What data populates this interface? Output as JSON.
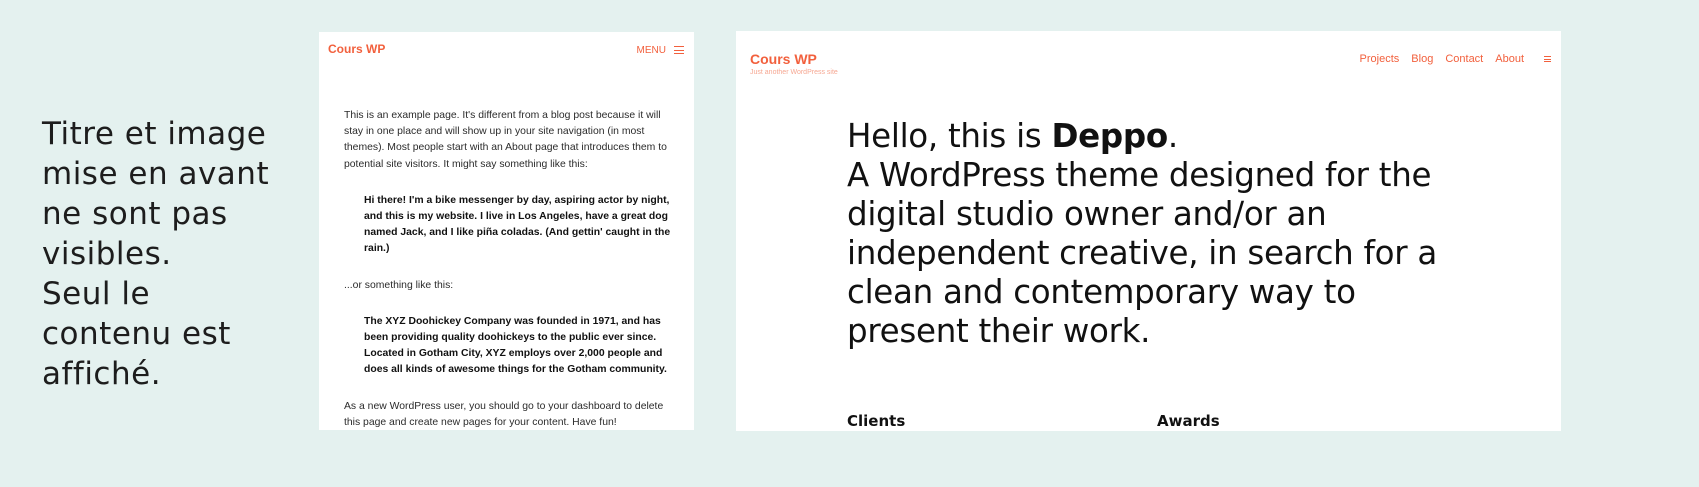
{
  "caption": {
    "lines": [
      "Titre et image",
      "mise en avant",
      "ne sont pas",
      "visibles.",
      "Seul le",
      "contenu est",
      "affiché."
    ]
  },
  "mobile": {
    "site_title": "Cours WP",
    "menu_label": "MENU",
    "menu_icon": "hamburger-icon",
    "paragraphs": [
      "This is an example page. It's different from a blog post because it will stay in one place and will show up in your site navigation (in most themes). Most people start with an About page that introduces them to potential site visitors. It might say something like this:",
      "...or something like this:",
      "As a new WordPress user, you should go to your dashboard to delete this page and create new pages for your content. Have fun!"
    ],
    "quotes": [
      "Hi there! I'm a bike messenger by day, aspiring actor by night, and this is my website. I live in Los Angeles, have a great dog named Jack, and I like piña coladas. (And gettin' caught in the rain.)",
      "The XYZ Doohickey Company was founded in 1971, and has been providing quality doohickeys to the public ever since. Located in Gotham City, XYZ employs over 2,000 people and does all kinds of awesome things for the Gotham community."
    ]
  },
  "desktop": {
    "site_title": "Cours WP",
    "tagline": "Just another WordPress site",
    "nav": [
      "Projects",
      "Blog",
      "Contact",
      "About"
    ],
    "menu_icon": "hamburger-icon",
    "hero": {
      "intro": "Hello, this is ",
      "name": "Deppo",
      "intro_end": ".",
      "lines": [
        "A WordPress theme designed for the",
        "digital studio owner and/or an",
        "independent creative, in search for a",
        "clean and contemporary way to",
        "present their work."
      ]
    },
    "columns": [
      "Clients",
      "Awards"
    ]
  },
  "colors": {
    "background": "#e4f1ef",
    "accent": "#f2603d"
  }
}
